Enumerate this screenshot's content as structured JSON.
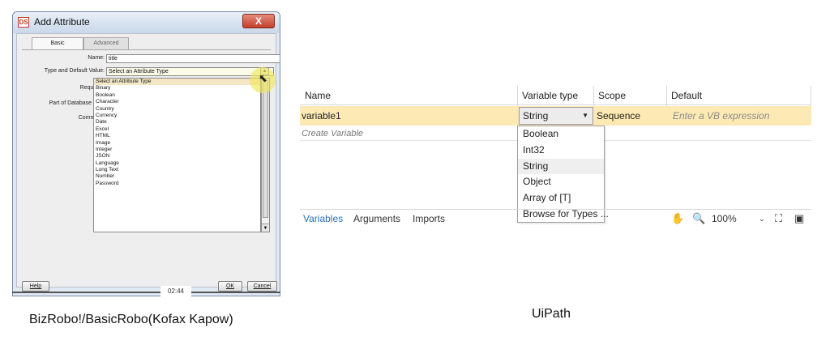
{
  "left_dialog": {
    "title": "Add Attribute",
    "logo_text": "DS",
    "close_symbol": "X",
    "tabs": [
      "Basic",
      "Advanced"
    ],
    "labels": {
      "name": "Name:",
      "type_default": "Type and Default Value:",
      "required": "Required:",
      "db_key": "Part of Database Key:",
      "comment": "Comment:"
    },
    "name_value": "title",
    "type_selected": "Select an Attribute Type",
    "type_options": [
      "Select an Attribute Type",
      "Binary",
      "Boolean",
      "Character",
      "Country",
      "Currency",
      "Date",
      "Excel",
      "HTML",
      "Image",
      "Integer",
      "JSON",
      "Language",
      "Long Text",
      "Number",
      "Password"
    ],
    "help_label": "Help",
    "ok_label": "OK",
    "cancel_label": "Cancel",
    "timer": "02:44"
  },
  "uipath": {
    "columns": [
      "Name",
      "Variable type",
      "Scope",
      "Default"
    ],
    "row": {
      "name": "variable1",
      "type": "String",
      "scope": "Sequence",
      "default_placeholder": "Enter a VB expression"
    },
    "create_variable": "Create Variable",
    "type_options": [
      "Boolean",
      "Int32",
      "String",
      "Object",
      "Array of [T]",
      "Browse for Types ..."
    ],
    "footer_tabs": [
      "Variables",
      "Arguments",
      "Imports"
    ],
    "zoom": "100%",
    "accent_color": "#2b6fb6",
    "row_highlight_color": "#fde9b3"
  },
  "captions": {
    "left": "BizRobo!/BasicRobo(Kofax Kapow)",
    "right": "UiPath"
  }
}
